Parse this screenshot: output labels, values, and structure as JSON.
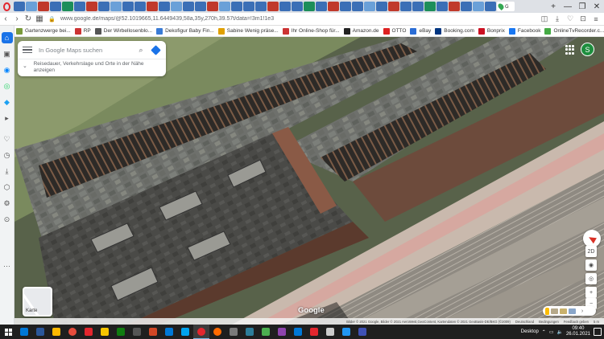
{
  "colors": {
    "opera_red": "#e3262e",
    "maps_blue": "#1a73e8",
    "avatar_green": "#1e8e3e",
    "taskbar": "#1f1f1f"
  },
  "browser": {
    "tabs": [
      "tab",
      "tab",
      "tab",
      "tab",
      "tab",
      "tab",
      "tab",
      "tab",
      "tab",
      "tab",
      "tab",
      "tab",
      "tab",
      "tab",
      "tab",
      "tab",
      "tab",
      "tab",
      "tab",
      "tab",
      "tab",
      "tab",
      "tab",
      "tab",
      "tab",
      "tab",
      "tab",
      "tab",
      "tab",
      "tab",
      "tab",
      "tab",
      "tab",
      "tab",
      "tab",
      "tab",
      "tab",
      "tab",
      "tab",
      "tab"
    ],
    "active_tab_label": "G",
    "url": "www.google.de/maps/@52.1019665,11.6449439,58a,35y,270h,39.57t/data=!3m1!1e3",
    "window_controls": [
      "—",
      "❐",
      "✕"
    ]
  },
  "bookmarks": [
    {
      "label": "Gartenzwerge bei...",
      "color": "#7a9a3a"
    },
    {
      "label": "RP",
      "color": "#c33"
    },
    {
      "label": "Der Wirbellosenblo...",
      "color": "#555"
    },
    {
      "label": "Dekofigur Baby Fin...",
      "color": "#3a7bd5"
    },
    {
      "label": "Sabine Wenig präse...",
      "color": "#e0a000"
    },
    {
      "label": "Ihr Online-Shop für...",
      "color": "#c33"
    },
    {
      "label": "Amazon.de",
      "color": "#222"
    },
    {
      "label": "OTTO",
      "color": "#d22"
    },
    {
      "label": "eBay",
      "color": "#2b6dd6"
    },
    {
      "label": "Booking.com",
      "color": "#003580"
    },
    {
      "label": "Bonprix",
      "color": "#c12"
    },
    {
      "label": "Facebook",
      "color": "#1877f2"
    },
    {
      "label": "OnlineTvRecorder.c...",
      "color": "#4a4"
    }
  ],
  "search": {
    "placeholder": "In Google Maps suchen",
    "travel_info": "Reisedauer, Verkehrslage und Orte in der Nähe anzeigen"
  },
  "user": {
    "avatar_letter": "S"
  },
  "map": {
    "google_logo": "Google",
    "layers_label": "Karte",
    "tilt_label": "2D",
    "zoom_in": "+",
    "zoom_out": "−"
  },
  "attribution": {
    "imagery": "Bilder © 2021 Google, Bilder © 2021 AeroWest,GeoContent, Kartendaten © 2021 GeoBasis-DE/BKG (©2009)",
    "country": "Deutschland",
    "terms": "Bedingungen",
    "feedback": "Feedback geben",
    "scale": "5 m"
  },
  "taskbar": {
    "desktop_label": "Desktop",
    "time": "09:40",
    "date": "26.01.2021"
  }
}
